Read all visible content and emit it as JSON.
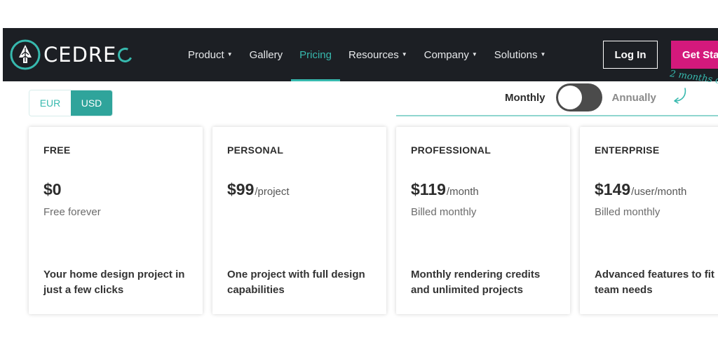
{
  "nav": {
    "logo_text": "CEDRE",
    "items": [
      {
        "label": "Product",
        "dropdown": true,
        "active": false
      },
      {
        "label": "Gallery",
        "dropdown": false,
        "active": false
      },
      {
        "label": "Pricing",
        "dropdown": false,
        "active": true
      },
      {
        "label": "Resources",
        "dropdown": true,
        "active": false
      },
      {
        "label": "Company",
        "dropdown": true,
        "active": false
      },
      {
        "label": "Solutions",
        "dropdown": true,
        "active": false
      }
    ],
    "login_label": "Log In",
    "get_started_label": "Get Sta"
  },
  "currency": {
    "options": [
      "EUR",
      "USD"
    ],
    "selected": "USD"
  },
  "billing": {
    "monthly_label": "Monthly",
    "annually_label": "Annually",
    "selected": "Monthly",
    "promo_note": "2 months o"
  },
  "plans": [
    {
      "name": "FREE",
      "price": "$0",
      "unit": "",
      "sub": "Free forever",
      "desc": "Your home design project in just a few clicks"
    },
    {
      "name": "PERSONAL",
      "price": "$99",
      "unit": "/project",
      "sub": "",
      "desc": "One project with full design capabilities"
    },
    {
      "name": "PROFESSIONAL",
      "price": "$119",
      "unit": "/month",
      "sub": "Billed monthly",
      "desc": "Monthly rendering credits and unlimited projects"
    },
    {
      "name": "ENTERPRISE",
      "price": "$149",
      "unit": "/user/month",
      "sub": "Billed monthly",
      "desc": "Advanced features to fit team needs"
    }
  ],
  "colors": {
    "nav_bg": "#1c1f24",
    "accent_teal": "#37b9ae",
    "cta_pink": "#d4197c"
  }
}
